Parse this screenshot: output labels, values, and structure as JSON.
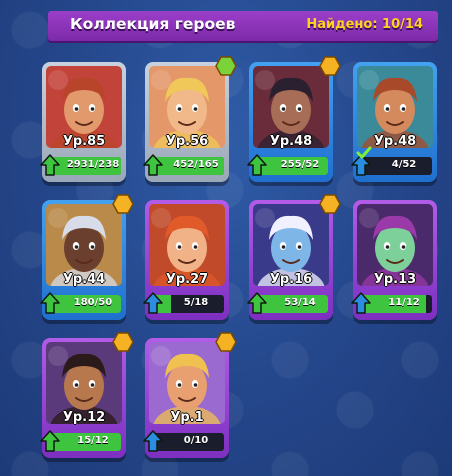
{
  "header": {
    "title": "Коллекция героев",
    "found": "Найдено: 10/14"
  },
  "colors": {
    "upgrade_green": "#3ec43e",
    "locked_blue": "#2b8de0",
    "gold_hex": "#f5b323",
    "green_hex": "#7bd33a"
  },
  "heroes": [
    {
      "level": "Ур.85",
      "progress": "2931/238",
      "fill": 1.0,
      "frame": "grey",
      "arrow": "green",
      "hex": "none",
      "hair": "#b8452a",
      "skin": "#e29a6c",
      "bg": "#c2433a"
    },
    {
      "level": "Ур.56",
      "progress": "452/165",
      "fill": 1.0,
      "frame": "grey",
      "arrow": "green",
      "hex": "green",
      "hair": "#f0c85a",
      "skin": "#f1b98a",
      "bg": "#e4986a"
    },
    {
      "level": "Ур.48",
      "progress": "255/52",
      "fill": 1.0,
      "frame": "blue",
      "arrow": "green",
      "hex": "gold",
      "hair": "#2b2030",
      "skin": "#a86d56",
      "bg": "#6a2c3a"
    },
    {
      "level": "Ур.48",
      "progress": "4/52",
      "fill": 0.08,
      "frame": "blue",
      "arrow": "blue",
      "hex": "none",
      "hair": "#a8492a",
      "skin": "#d48a5c",
      "bg": "#3a8a9a",
      "check": true
    },
    {
      "level": "Ур.44",
      "progress": "180/50",
      "fill": 1.0,
      "frame": "blue",
      "arrow": "green",
      "hex": "gold",
      "hair": "#d8dbe8",
      "skin": "#6b3f2e",
      "bg": "#b98a4a"
    },
    {
      "level": "Ур.27",
      "progress": "5/18",
      "fill": 0.28,
      "frame": "purple",
      "arrow": "blue",
      "hex": "none",
      "hair": "#e05a2a",
      "skin": "#f0b286",
      "bg": "#c04a2a"
    },
    {
      "level": "Ур.16",
      "progress": "53/14",
      "fill": 1.0,
      "frame": "purple",
      "arrow": "green",
      "hex": "gold",
      "hair": "#f0f0ff",
      "skin": "#7fb6e8",
      "bg": "#3a3a8a"
    },
    {
      "level": "Ур.13",
      "progress": "11/12",
      "fill": 0.92,
      "frame": "purple",
      "arrow": "blue",
      "hex": "none",
      "hair": "#9a3aa8",
      "skin": "#7ed09a",
      "bg": "#4a2a6a"
    },
    {
      "level": "Ур.12",
      "progress": "15/12",
      "fill": 1.0,
      "frame": "purple",
      "arrow": "green",
      "hex": "gold",
      "hair": "#2a1a1a",
      "skin": "#b8784e",
      "bg": "#5a3a7a"
    },
    {
      "level": "Ур.1",
      "progress": "0/10",
      "fill": 0.0,
      "frame": "purple",
      "arrow": "blue",
      "hex": "gold",
      "hair": "#f0c050",
      "skin": "#e8a070",
      "bg": "#9a6ad0"
    }
  ]
}
